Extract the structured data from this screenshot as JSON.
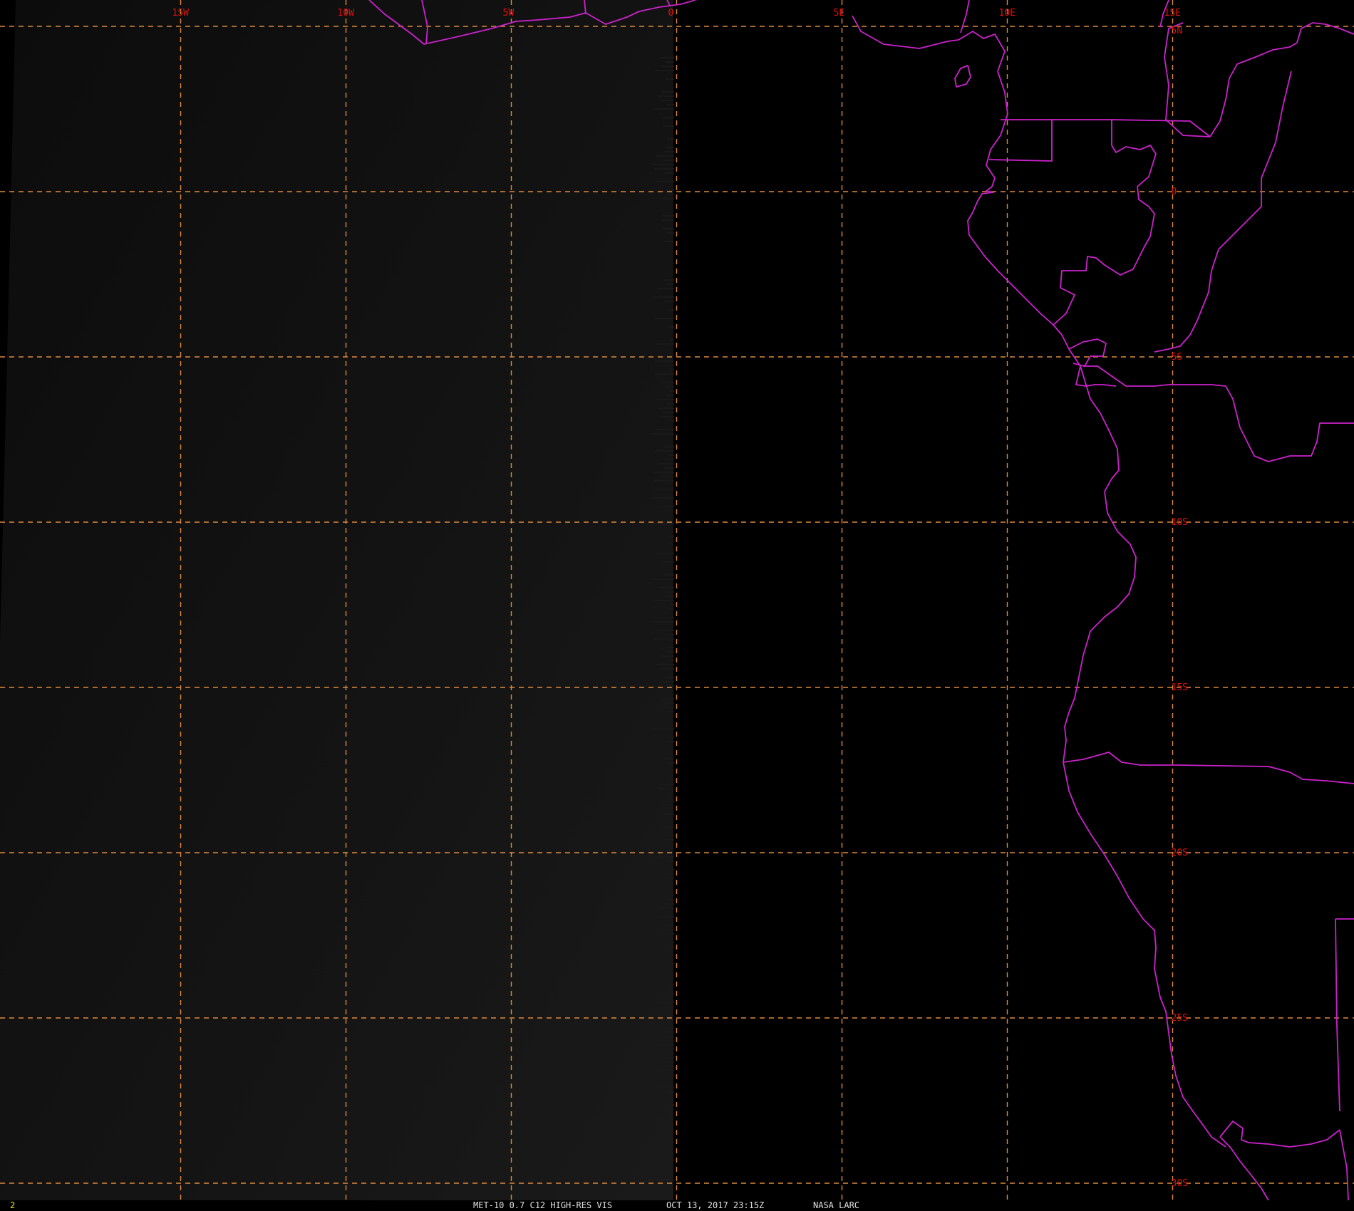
{
  "image": {
    "satellite": "MET-10",
    "band": "0.7",
    "channel": "C12",
    "product": "HIGH-RES VIS",
    "product_text": "MET-10 0.7 C12 HIGH-RES VIS",
    "timestamp_text": "OCT 13, 2017 23:15Z",
    "source_text": "NASA LARC",
    "frame_number": "2"
  },
  "map": {
    "longitude_labels": [
      "15W",
      "10W",
      "5W",
      "0",
      "5E",
      "10E",
      "15E"
    ],
    "latitude_labels": [
      "5N",
      "0",
      "5S",
      "10S",
      "15S",
      "20S",
      "25S",
      "30S"
    ],
    "longitudes": [
      -15,
      -10,
      -5,
      0,
      5,
      10,
      15
    ],
    "latitudes": [
      5,
      0,
      -5,
      -10,
      -15,
      -20,
      -25,
      -30
    ],
    "colors": {
      "grid": "#e08a3a",
      "grid_label": "#e01010",
      "coastline": "#cc22cc",
      "background": "#000000",
      "status_text": "#e0e0e0",
      "frame_text": "#e8e820"
    }
  }
}
